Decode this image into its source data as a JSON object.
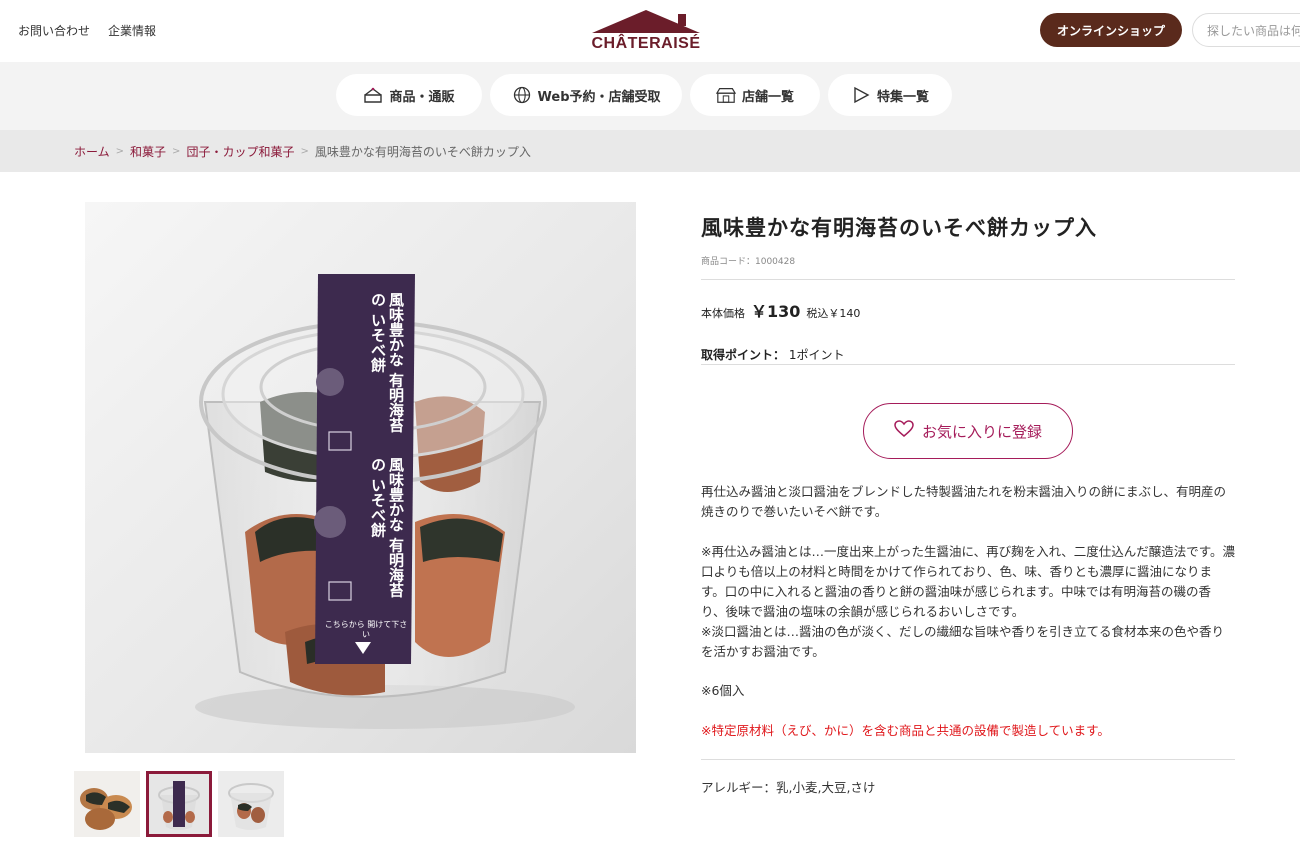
{
  "header": {
    "links": [
      "お問い合わせ",
      "企業情報"
    ],
    "logo_text": "CHÂTERAISÉ",
    "shop_label": "オンラインショップ",
    "search_placeholder": "探したい商品は何"
  },
  "nav": {
    "items": [
      {
        "label": "商品・通販",
        "icon": "cake-icon"
      },
      {
        "label": "Web予約・店舗受取",
        "icon": "globe-icon"
      },
      {
        "label": "店舗一覧",
        "icon": "store-icon"
      },
      {
        "label": "特集一覧",
        "icon": "play-icon"
      }
    ]
  },
  "breadcrumb": {
    "items": [
      "ホーム",
      "和菓子",
      "団子・カップ和菓子"
    ],
    "separator": ">",
    "current": "風味豊かな有明海苔のいそべ餅カップ入"
  },
  "product": {
    "title": "風味豊かな有明海苔のいそべ餅カップ入",
    "code": "商品コード：1000428",
    "price_label": "本体価格",
    "price": "￥130",
    "tax_price": "税込￥140",
    "points_label": "取得ポイント：",
    "points_value": "1ポイント",
    "fav_label": "お気に入りに登録",
    "description_1": "再仕込み醤油と淡口醤油をブレンドした特製醤油たれを粉末醤油入りの餅にまぶし、有明産の焼きのりで巻いたいそべ餅です。",
    "description_2": "※再仕込み醤油とは…一度出来上がった生醤油に、再び麹を入れ、二度仕込んだ醸造法です。濃口よりも倍以上の材料と時間をかけて作られており、色、味、香りとも濃厚に醤油になります。口の中に入れると醤油の香りと餅の醤油味が感じられます。中味では有明海苔の磯の香り、後味で醤油の塩味の余韻が感じられるおいしさです。",
    "description_3": "※淡口醤油とは…醤油の色が淡く、だしの繊細な旨味や香りを引き立てる食材本来の色や香りを活かすお醤油です。",
    "quantity_note": "※6個入",
    "warning": "※特定原材料（えび、かに）を含む商品と共通の設備で製造しています。",
    "allergy": "アレルギー：乳,小麦,大豆,さけ"
  },
  "packaging_label": {
    "text_top": "風味豊かな 有明海苔の いそべ餅",
    "open_here": "こちらから 開けて下さい"
  },
  "colors": {
    "brand": "#6b1d2a",
    "shop_button": "#5a2a1c",
    "accent": "#a51c5a",
    "warning": "#e0181c",
    "label_purple": "#3d2a4e"
  }
}
